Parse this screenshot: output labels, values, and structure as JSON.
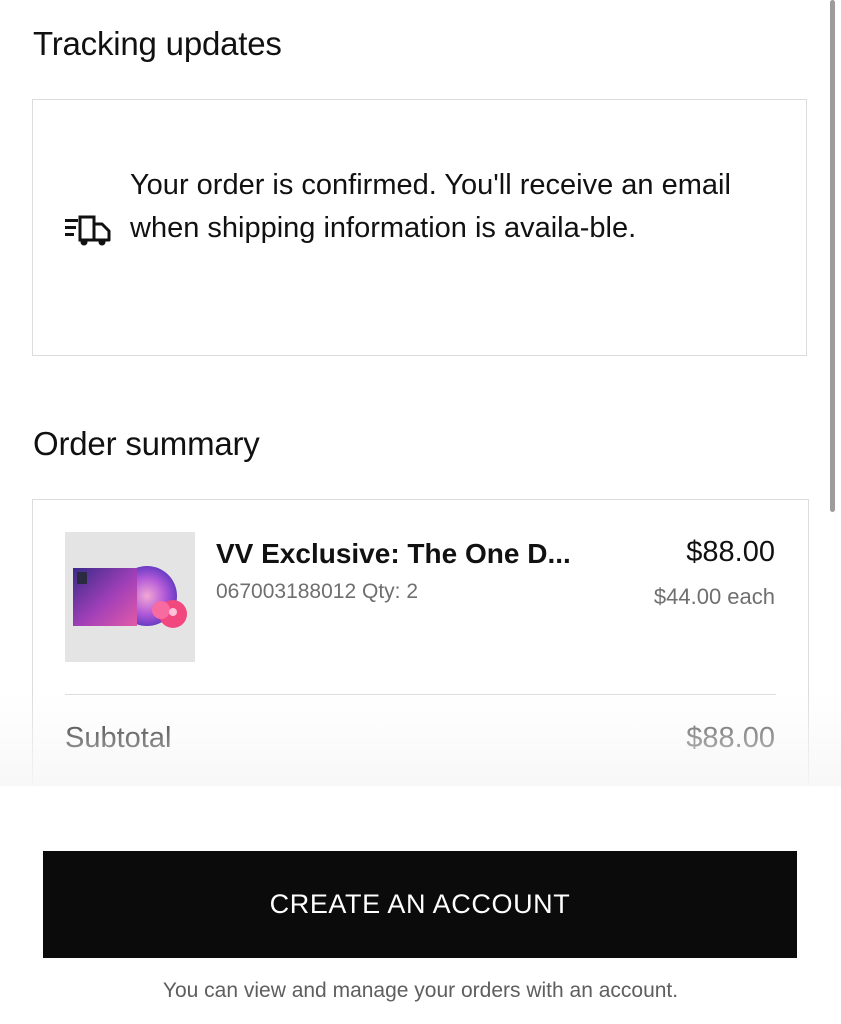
{
  "tracking": {
    "title": "Tracking updates",
    "icon": "delivery-truck-icon",
    "message": "Your order is confirmed. You'll receive an email when shipping information is availa-ble."
  },
  "summary": {
    "title": "Order summary",
    "item": {
      "name": "VV Exclusive: The One D...",
      "meta": "067003188012 Qty: 2",
      "total": "$88.00",
      "each": "$44.00 each",
      "thumb_icon": "album-vinyl-thumbnail"
    },
    "subtotal_label": "Subtotal",
    "subtotal_value": "$88.00"
  },
  "account": {
    "button_label": "CREATE AN ACCOUNT",
    "hint": "You can view and manage your orders with an account."
  },
  "colors": {
    "button_bg": "#0b0b0b",
    "border": "#dcdcdc",
    "muted_text": "#6f6f6f"
  }
}
